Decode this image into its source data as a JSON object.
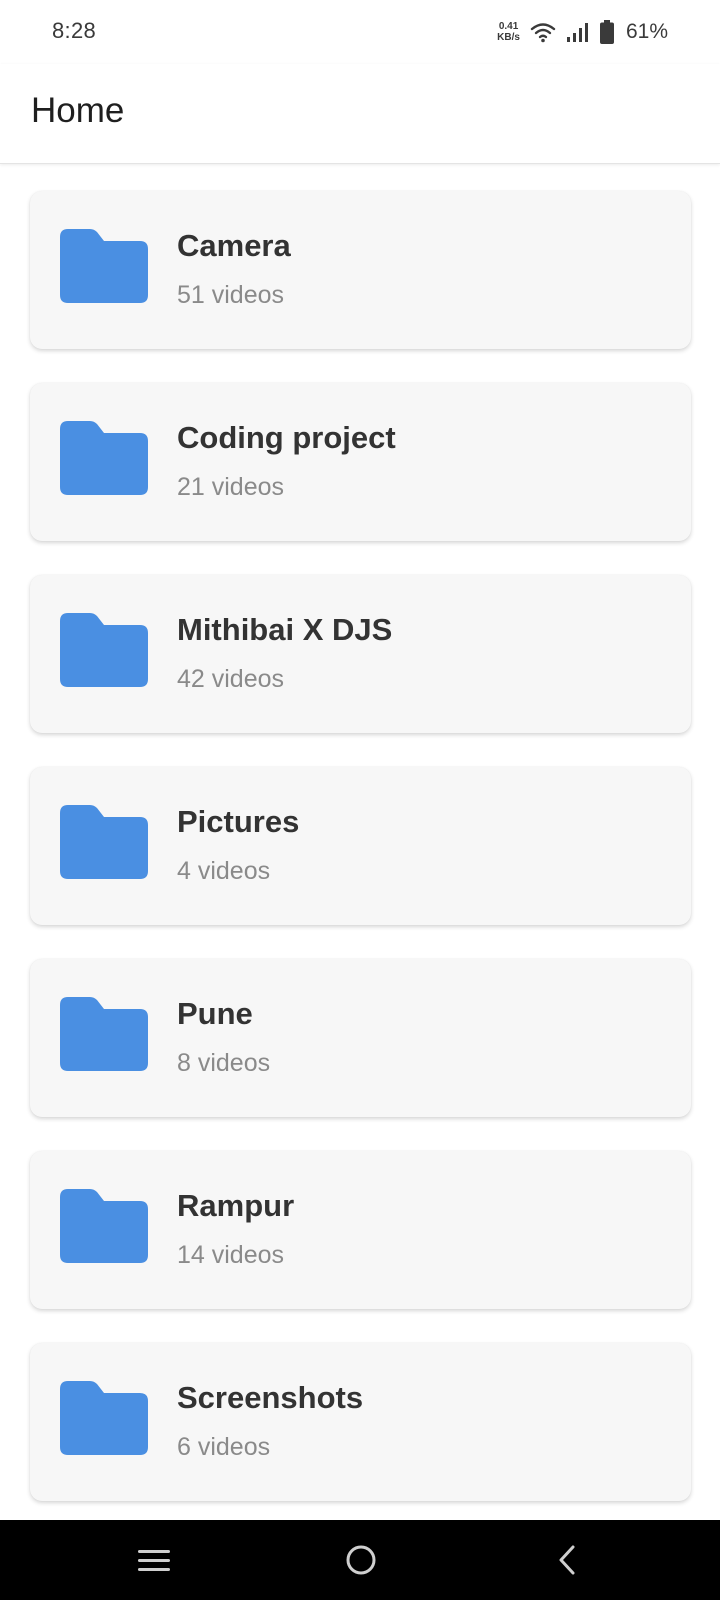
{
  "status_bar": {
    "time": "8:28",
    "net_speed_value": "0.41",
    "net_speed_unit": "KB/s",
    "battery_percent": "61%",
    "icons": [
      "wifi-icon",
      "signal-icon",
      "battery-icon"
    ]
  },
  "header": {
    "title": "Home"
  },
  "folders": [
    {
      "name": "Camera",
      "count": "51 videos"
    },
    {
      "name": "Coding project",
      "count": "21 videos"
    },
    {
      "name": "Mithibai X DJS",
      "count": "42 videos"
    },
    {
      "name": "Pictures",
      "count": "4 videos"
    },
    {
      "name": "Pune",
      "count": "8 videos"
    },
    {
      "name": "Rampur",
      "count": "14 videos"
    },
    {
      "name": "Screenshots",
      "count": "6 videos"
    }
  ],
  "nav_bar": {
    "icons": [
      "menu-icon",
      "home-icon",
      "back-icon"
    ]
  },
  "colors": {
    "folder_icon": "#4a8fe2",
    "card_background": "#f7f7f7",
    "nav_background": "#000000"
  }
}
